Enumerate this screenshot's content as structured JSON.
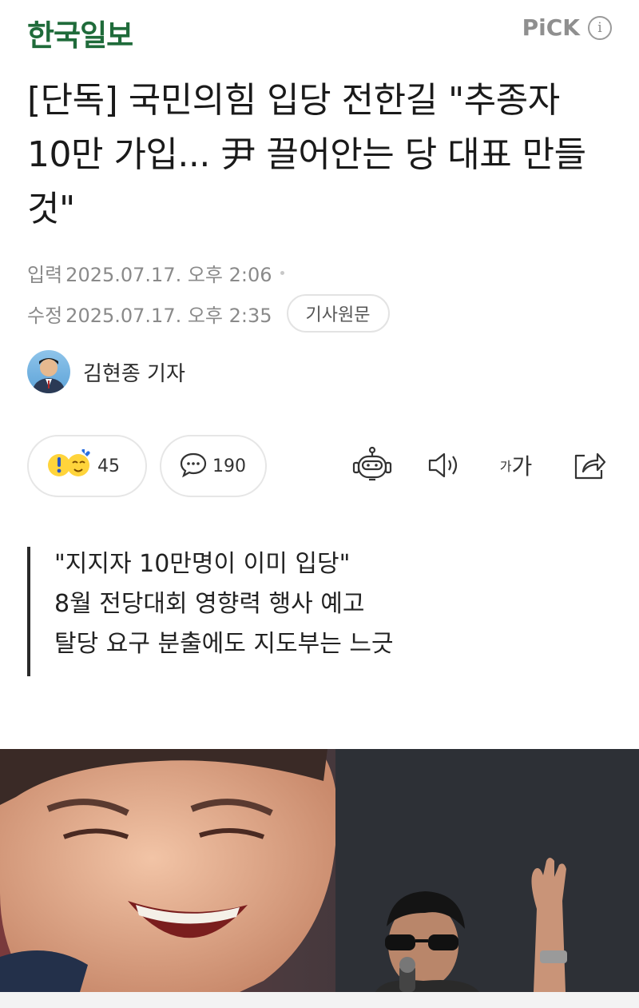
{
  "header": {
    "brand": "한국일보",
    "pick_label": "PiCK",
    "info_icon": "i"
  },
  "headline": "[단독] 국민의힘 입당 전한길 \"추종자 10만 가입... 尹 끌어안는 당 대표 만들 것\"",
  "meta": {
    "input_label": "입력",
    "input_time": "2025.07.17. 오후 2:06",
    "edit_label": "수정",
    "edit_time": "2025.07.17. 오후 2:35",
    "original_button": "기사원문"
  },
  "reporter": {
    "name": "김현종 기자"
  },
  "actions": {
    "reaction_count": "45",
    "comment_count": "190",
    "font_small": "가",
    "font_big": "가"
  },
  "summary": [
    "\"지지자 10만명이 이미 입당\"",
    "8월 전당대회 영향력 행사 예고",
    "탈당 요구 분출에도 지도부는 느긋"
  ],
  "colors": {
    "brand": "#1f6b3a",
    "meta_gray": "#8a8a8a"
  }
}
